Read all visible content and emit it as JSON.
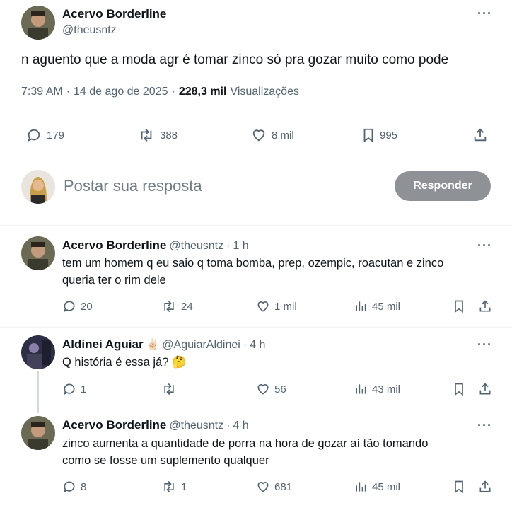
{
  "main_post": {
    "author_name": "Acervo Borderline",
    "author_handle": "@theusntz",
    "text": "n aguento que a moda agr é tomar zinco só pra gozar muito como pode",
    "time": "7:39 AM",
    "date": "14 de ago de 2025",
    "views_count": "228,3 mil",
    "views_label": "Visualizações",
    "separator": "·",
    "stats": {
      "replies": "179",
      "reposts": "388",
      "likes": "8 mil",
      "bookmarks": "995"
    }
  },
  "compose": {
    "placeholder": "Postar sua resposta",
    "reply_button": "Responder"
  },
  "replies": [
    {
      "author_name": "Acervo Borderline",
      "author_handle": "@theusntz",
      "time_ago": "1 h",
      "text_line1": "tem um homem q eu saio q toma bomba, prep, ozempic, roacutan e zinco",
      "text_line2": "queria ter o rim dele",
      "replies": "20",
      "reposts": "24",
      "likes": "1 mil",
      "views": "45 mil"
    },
    {
      "author_name": "Aldinei Aguiar",
      "author_emoji": "✌🏻",
      "author_handle": "@AguiarAldinei",
      "time_ago": "4 h",
      "text_line1": "Q história é essa já? 🤔",
      "replies": "1",
      "reposts": "",
      "likes": "56",
      "views": "43 mil"
    },
    {
      "author_name": "Acervo Borderline",
      "author_handle": "@theusntz",
      "time_ago": "4 h",
      "text_line1": "zinco aumenta a quantidade de porra na hora de gozar aí tão tomando",
      "text_line2": "como se fosse um suplemento qualquer",
      "replies": "8",
      "reposts": "1",
      "likes": "681",
      "views": "45 mil"
    }
  ],
  "more_label": "···",
  "icons": [
    "more-icon",
    "reply-icon",
    "repost-icon",
    "like-icon",
    "bookmark-icon",
    "share-icon",
    "views-icon"
  ],
  "colors": {
    "text": "#0f1419",
    "muted": "#536471",
    "divider": "#eff3f4",
    "reply_button": "#8e9296"
  }
}
